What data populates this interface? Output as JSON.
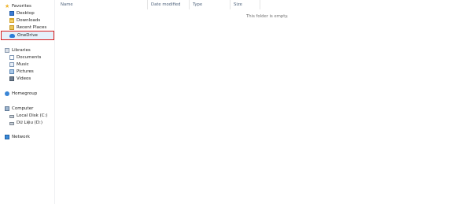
{
  "navigation": {
    "favorites": {
      "label": "Favorites",
      "items": [
        {
          "label": "Desktop"
        },
        {
          "label": "Downloads"
        },
        {
          "label": "Recent Places"
        },
        {
          "label": "OneDrive"
        }
      ]
    },
    "libraries": {
      "label": "Libraries",
      "items": [
        {
          "label": "Documents"
        },
        {
          "label": "Music"
        },
        {
          "label": "Pictures"
        },
        {
          "label": "Videos"
        }
      ]
    },
    "homegroup": {
      "label": "Homegroup"
    },
    "computer": {
      "label": "Computer",
      "items": [
        {
          "label": "Local Disk (C:)"
        },
        {
          "label": "Dữ Liệu (D:)"
        }
      ]
    },
    "network": {
      "label": "Network"
    }
  },
  "file_list": {
    "columns": {
      "name": "Name",
      "date_modified": "Date modified",
      "type": "Type",
      "size": "Size"
    },
    "empty_message": "This folder is empty."
  },
  "colors": {
    "selection_highlight": "#d92020",
    "accent": "#2b7bd8"
  }
}
